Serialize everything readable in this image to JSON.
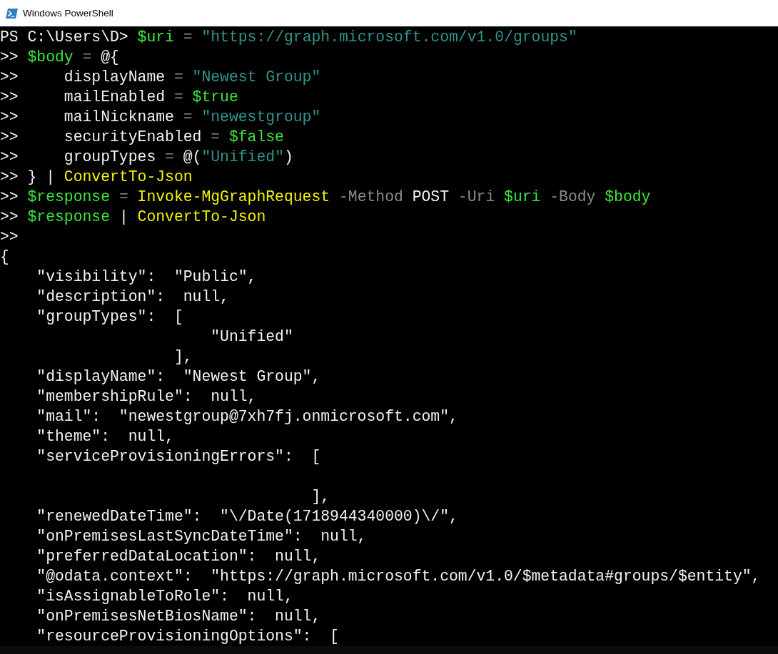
{
  "window": {
    "title": "Windows PowerShell"
  },
  "lines": [
    {
      "tokens": [
        {
          "kind": "plain",
          "text": "PS C:\\Users\\D> "
        },
        {
          "kind": "variable",
          "text": "$uri"
        },
        {
          "kind": "operator",
          "text": " = "
        },
        {
          "kind": "string",
          "text": "\"https://graph.microsoft.com/v1.0/groups\""
        }
      ]
    },
    {
      "tokens": [
        {
          "kind": "plain",
          "text": ">> "
        },
        {
          "kind": "variable",
          "text": "$body"
        },
        {
          "kind": "operator",
          "text": " = "
        },
        {
          "kind": "plain",
          "text": "@{"
        }
      ]
    },
    {
      "tokens": [
        {
          "kind": "plain",
          "text": ">>     displayName"
        },
        {
          "kind": "operator",
          "text": " = "
        },
        {
          "kind": "string",
          "text": "\"Newest Group\""
        }
      ]
    },
    {
      "tokens": [
        {
          "kind": "plain",
          "text": ">>     mailEnabled"
        },
        {
          "kind": "operator",
          "text": " = "
        },
        {
          "kind": "variable",
          "text": "$true"
        }
      ]
    },
    {
      "tokens": [
        {
          "kind": "plain",
          "text": ">>     mailNickname"
        },
        {
          "kind": "operator",
          "text": " = "
        },
        {
          "kind": "string",
          "text": "\"newestgroup\""
        }
      ]
    },
    {
      "tokens": [
        {
          "kind": "plain",
          "text": ">>     securityEnabled"
        },
        {
          "kind": "operator",
          "text": " = "
        },
        {
          "kind": "variable",
          "text": "$false"
        }
      ]
    },
    {
      "tokens": [
        {
          "kind": "plain",
          "text": ">>     groupTypes"
        },
        {
          "kind": "operator",
          "text": " = "
        },
        {
          "kind": "plain",
          "text": "@("
        },
        {
          "kind": "string",
          "text": "\"Unified\""
        },
        {
          "kind": "plain",
          "text": ")"
        }
      ]
    },
    {
      "tokens": [
        {
          "kind": "plain",
          "text": ">> } | "
        },
        {
          "kind": "command",
          "text": "ConvertTo-Json"
        }
      ]
    },
    {
      "tokens": [
        {
          "kind": "plain",
          "text": ">> "
        },
        {
          "kind": "variable",
          "text": "$response"
        },
        {
          "kind": "operator",
          "text": " = "
        },
        {
          "kind": "command",
          "text": "Invoke-MgGraphRequest"
        },
        {
          "kind": "parameter",
          "text": " -Method"
        },
        {
          "kind": "plain",
          "text": " POST"
        },
        {
          "kind": "parameter",
          "text": " -Uri"
        },
        {
          "kind": "variable",
          "text": " $uri"
        },
        {
          "kind": "parameter",
          "text": " -Body"
        },
        {
          "kind": "variable",
          "text": " $body"
        }
      ]
    },
    {
      "tokens": [
        {
          "kind": "plain",
          "text": ">> "
        },
        {
          "kind": "variable",
          "text": "$response"
        },
        {
          "kind": "plain",
          "text": " | "
        },
        {
          "kind": "command",
          "text": "ConvertTo-Json"
        }
      ]
    },
    {
      "tokens": [
        {
          "kind": "plain",
          "text": ">>"
        }
      ]
    },
    {
      "tokens": [
        {
          "kind": "output",
          "text": "{"
        }
      ]
    },
    {
      "tokens": [
        {
          "kind": "output",
          "text": "    \"visibility\":  \"Public\","
        }
      ]
    },
    {
      "tokens": [
        {
          "kind": "output",
          "text": "    \"description\":  null,"
        }
      ]
    },
    {
      "tokens": [
        {
          "kind": "output",
          "text": "    \"groupTypes\":  ["
        }
      ]
    },
    {
      "tokens": [
        {
          "kind": "output",
          "text": "                       \"Unified\""
        }
      ]
    },
    {
      "tokens": [
        {
          "kind": "output",
          "text": "                   ],"
        }
      ]
    },
    {
      "tokens": [
        {
          "kind": "output",
          "text": "    \"displayName\":  \"Newest Group\","
        }
      ]
    },
    {
      "tokens": [
        {
          "kind": "output",
          "text": "    \"membershipRule\":  null,"
        }
      ]
    },
    {
      "tokens": [
        {
          "kind": "output",
          "text": "    \"mail\":  \"newestgroup@7xh7fj.onmicrosoft.com\","
        }
      ]
    },
    {
      "tokens": [
        {
          "kind": "output",
          "text": "    \"theme\":  null,"
        }
      ]
    },
    {
      "tokens": [
        {
          "kind": "output",
          "text": "    \"serviceProvisioningErrors\":  ["
        }
      ]
    },
    {
      "kind": "blank"
    },
    {
      "tokens": [
        {
          "kind": "output",
          "text": "                                  ],"
        }
      ]
    },
    {
      "tokens": [
        {
          "kind": "output",
          "text": "    \"renewedDateTime\":  \"\\/Date(1718944340000)\\/\","
        }
      ]
    },
    {
      "tokens": [
        {
          "kind": "output",
          "text": "    \"onPremisesLastSyncDateTime\":  null,"
        }
      ]
    },
    {
      "tokens": [
        {
          "kind": "output",
          "text": "    \"preferredDataLocation\":  null,"
        }
      ]
    },
    {
      "tokens": [
        {
          "kind": "output",
          "text": "    \"@odata.context\":  \"https://graph.microsoft.com/v1.0/$metadata#groups/$entity\","
        }
      ]
    },
    {
      "tokens": [
        {
          "kind": "output",
          "text": "    \"isAssignableToRole\":  null,"
        }
      ]
    },
    {
      "tokens": [
        {
          "kind": "output",
          "text": "    \"onPremisesNetBiosName\":  null,"
        }
      ]
    },
    {
      "tokens": [
        {
          "kind": "output",
          "text": "    \"resourceProvisioningOptions\":  ["
        }
      ]
    }
  ]
}
